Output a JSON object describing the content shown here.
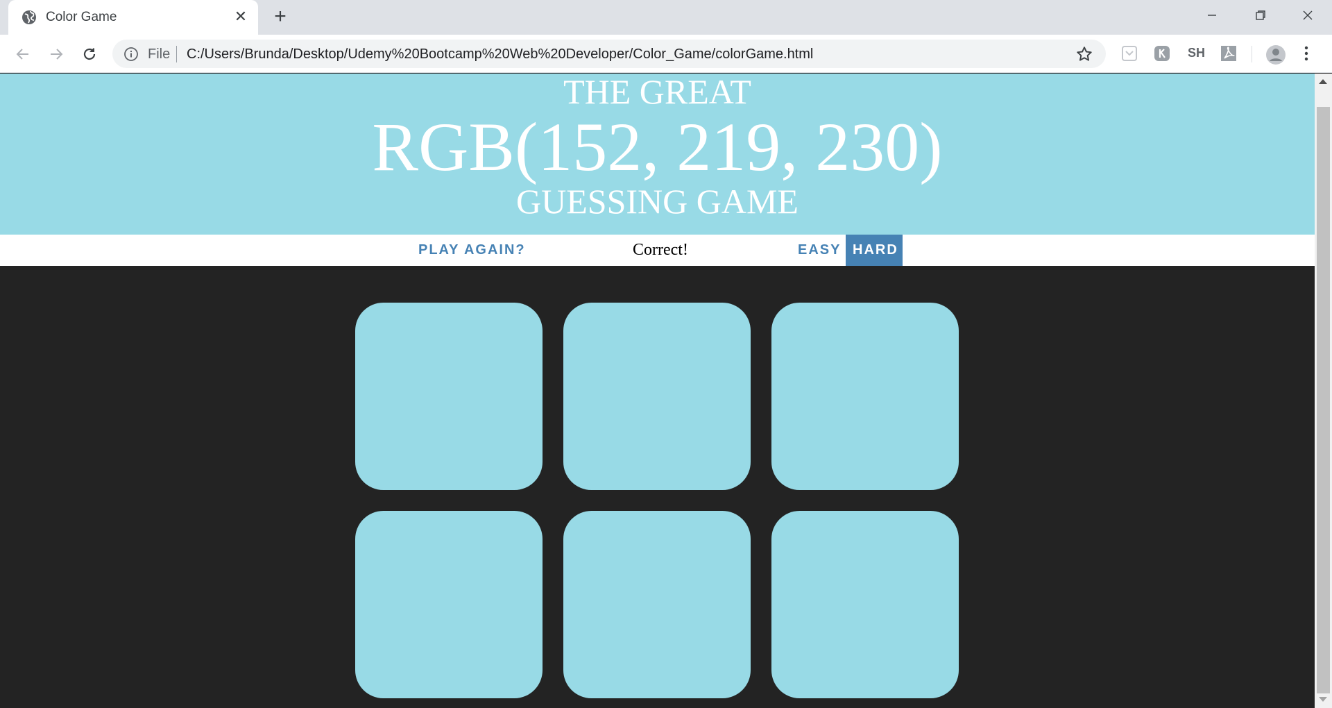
{
  "browser": {
    "tab_title": "Color Game",
    "address_scheme_label": "File",
    "url": "C:/Users/Brunda/Desktop/Udemy%20Bootcamp%20Web%20Developer/Color_Game/colorGame.html",
    "extension_label": "SH",
    "icons": [
      "globe-icon",
      "close-icon",
      "plus-icon",
      "minimize-icon",
      "restore-icon",
      "window-close-icon",
      "back-icon",
      "forward-icon",
      "reload-icon",
      "info-icon",
      "star-icon",
      "profile-icon",
      "menu-icon"
    ]
  },
  "header": {
    "line1": "THE GREAT",
    "color_display": "RGB(152, 219, 230)",
    "line3": "GUESSING GAME",
    "background": "#98dae6"
  },
  "stripe": {
    "play_again_label": "PLAY AGAIN?",
    "message": "Correct!",
    "easy_label": "EASY",
    "hard_label": "HARD",
    "selected_mode": "HARD",
    "accent": "#4682b4"
  },
  "squares": {
    "count": 6,
    "colors": [
      "#98dae6",
      "#98dae6",
      "#98dae6",
      "#98dae6",
      "#98dae6",
      "#98dae6"
    ]
  },
  "colors": {
    "body_background": "#232323"
  }
}
